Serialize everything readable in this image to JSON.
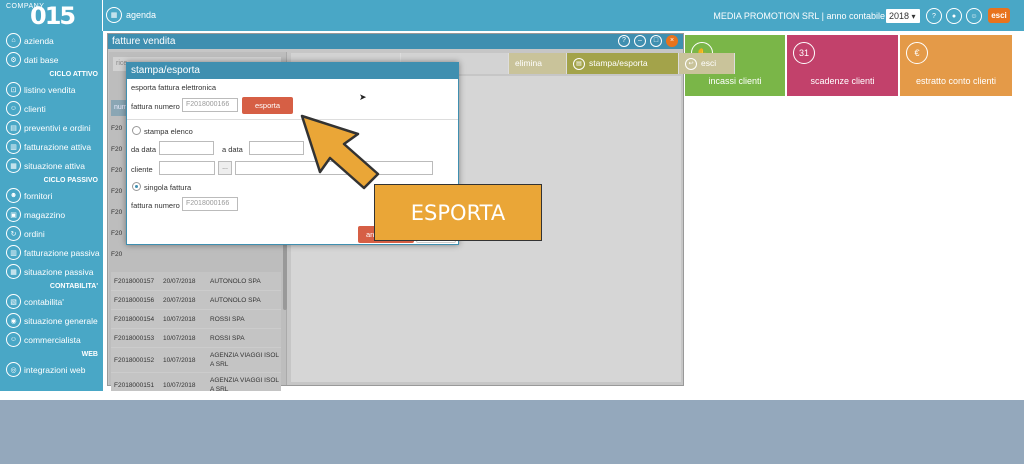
{
  "topbar": {
    "logo_top": "COMPANY",
    "logo_main": "015",
    "agenda_label": "agenda",
    "company_info": "MEDIA PROMOTION SRL | anno contabile",
    "year": "2018",
    "esci_label": "esci"
  },
  "sidebar": {
    "items": [
      {
        "label": "azienda",
        "icon": "home-icon",
        "glyph": "⌂"
      },
      {
        "label": "dati base",
        "icon": "gear-icon",
        "glyph": "⚙"
      },
      {
        "section": "CICLO ATTIVO"
      },
      {
        "label": "listino vendita",
        "icon": "cart-icon",
        "glyph": "⊡"
      },
      {
        "label": "clienti",
        "icon": "users-icon",
        "glyph": "☺"
      },
      {
        "label": "preventivi e ordini",
        "icon": "document-icon",
        "glyph": "▤"
      },
      {
        "label": "fatturazione attiva",
        "icon": "invoice-icon",
        "glyph": "▥"
      },
      {
        "label": "situazione attiva",
        "icon": "report-icon",
        "glyph": "▦"
      },
      {
        "section": "CICLO PASSIVO"
      },
      {
        "label": "fornitori",
        "icon": "suppliers-icon",
        "glyph": "☻"
      },
      {
        "label": "magazzino",
        "icon": "warehouse-icon",
        "glyph": "▣"
      },
      {
        "label": "ordini",
        "icon": "orders-icon",
        "glyph": "↻"
      },
      {
        "label": "fatturazione passiva",
        "icon": "invoice-icon",
        "glyph": "▥"
      },
      {
        "label": "situazione passiva",
        "icon": "report-icon",
        "glyph": "▦"
      },
      {
        "section": "CONTABILITA'"
      },
      {
        "label": "contabilita'",
        "icon": "ledger-icon",
        "glyph": "▧"
      },
      {
        "label": "situazione generale",
        "icon": "overview-icon",
        "glyph": "◉"
      },
      {
        "label": "commercialista",
        "icon": "accountant-icon",
        "glyph": "☺"
      },
      {
        "section": "WEB"
      },
      {
        "label": "integrazioni web",
        "icon": "web-icon",
        "glyph": "◎"
      }
    ]
  },
  "tiles": [
    {
      "label": "incassi clienti",
      "color": "#7ab648"
    },
    {
      "label": "scadenze clienti",
      "color": "#c2416b"
    },
    {
      "label": "estratto conto clienti",
      "color": "#e49a48"
    }
  ],
  "fatture_window": {
    "title": "fatture vendita",
    "search_placeholder": "rice",
    "col_header": "num",
    "toolbar": [
      {
        "label": "elimina",
        "active": false
      },
      {
        "label": "stampa/esporta",
        "active": true
      },
      {
        "label": "esci",
        "active": false
      }
    ],
    "rows": [
      {
        "numero": "F2018000157",
        "data": "20/07/2018",
        "cliente": "AUTONOLO SPA"
      },
      {
        "numero": "F2018000156",
        "data": "20/07/2018",
        "cliente": "AUTONOLO SPA"
      },
      {
        "numero": "F2018000154",
        "data": "10/07/2018",
        "cliente": "ROSSI SPA"
      },
      {
        "numero": "F2018000153",
        "data": "10/07/2018",
        "cliente": "ROSSI SPA"
      },
      {
        "numero": "F2018000152",
        "data": "10/07/2018",
        "cliente": "AGENZIA VIAGGI ISOL A SRL"
      },
      {
        "numero": "F2018000151",
        "data": "10/07/2018",
        "cliente": "AGENZIA VIAGGI ISOL A SRL"
      }
    ],
    "partial_rows": [
      "F20",
      "F20",
      "F20",
      "F20",
      "F20",
      "F20",
      "F20"
    ]
  },
  "dialog": {
    "title": "stampa/esporta",
    "section_label": "esporta fattura elettronica",
    "fattura_numero_label": "fattura numero",
    "fattura_numero_placeholder": "F2018000166",
    "esporta_button": "esporta",
    "stampa_elenco_label": "stampa elenco",
    "da_data_label": "da data",
    "a_data_label": "a data",
    "cliente_label": "cliente",
    "dots_label": "...",
    "singola_fattura_label": "singola fattura",
    "fattura_numero2_label": "fattura numero",
    "fattura_numero2_placeholder": "F2018000166",
    "footer_button": "an"
  },
  "callout": {
    "text": "ESPORTA",
    "color": "#eaa637"
  }
}
